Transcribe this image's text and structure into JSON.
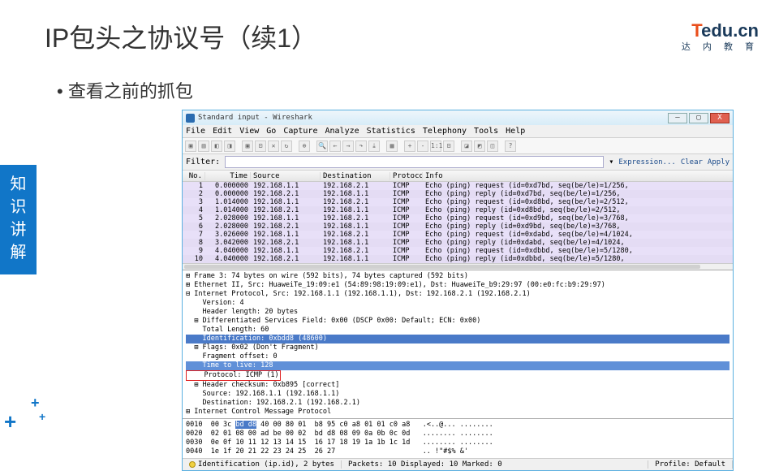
{
  "slide": {
    "title": "IP包头之协议号（续1）",
    "bullet": "• 查看之前的抓包",
    "sidebar": "知\n识\n讲\n解"
  },
  "logo": {
    "t": "T",
    "edu": "edu.cn",
    "sub": "达 内 教 育"
  },
  "window": {
    "title": "Standard input - Wireshark",
    "min": "–",
    "max": "▢",
    "close": "X"
  },
  "menu": [
    "File",
    "Edit",
    "View",
    "Go",
    "Capture",
    "Analyze",
    "Statistics",
    "Telephony",
    "Tools",
    "Help"
  ],
  "filter": {
    "label": "Filter:",
    "placeholder": "",
    "expr": "Expression...",
    "clear": "Clear",
    "apply": "Apply"
  },
  "cols": {
    "no": "No.",
    "time": "Time",
    "src": "Source",
    "dst": "Destination",
    "proto": "Protocol",
    "info": "Info"
  },
  "packets": [
    {
      "no": "1",
      "time": "0.000000",
      "src": "192.168.1.1",
      "dst": "192.168.2.1",
      "proto": "ICMP",
      "info": "Echo (ping) request  (id=0xd7bd, seq(be/le)=1/256,"
    },
    {
      "no": "2",
      "time": "0.000000",
      "src": "192.168.2.1",
      "dst": "192.168.1.1",
      "proto": "ICMP",
      "info": "Echo (ping) reply    (id=0xd7bd, seq(be/le)=1/256,"
    },
    {
      "no": "3",
      "time": "1.014000",
      "src": "192.168.1.1",
      "dst": "192.168.2.1",
      "proto": "ICMP",
      "info": "Echo (ping) request  (id=0xd8bd, seq(be/le)=2/512,"
    },
    {
      "no": "4",
      "time": "1.014000",
      "src": "192.168.2.1",
      "dst": "192.168.1.1",
      "proto": "ICMP",
      "info": "Echo (ping) reply    (id=0xd8bd, seq(be/le)=2/512,"
    },
    {
      "no": "5",
      "time": "2.028000",
      "src": "192.168.1.1",
      "dst": "192.168.2.1",
      "proto": "ICMP",
      "info": "Echo (ping) request  (id=0xd9bd, seq(be/le)=3/768,"
    },
    {
      "no": "6",
      "time": "2.028000",
      "src": "192.168.2.1",
      "dst": "192.168.1.1",
      "proto": "ICMP",
      "info": "Echo (ping) reply    (id=0xd9bd, seq(be/le)=3/768,"
    },
    {
      "no": "7",
      "time": "3.026000",
      "src": "192.168.1.1",
      "dst": "192.168.2.1",
      "proto": "ICMP",
      "info": "Echo (ping) request  (id=0xdabd, seq(be/le)=4/1024,"
    },
    {
      "no": "8",
      "time": "3.042000",
      "src": "192.168.2.1",
      "dst": "192.168.1.1",
      "proto": "ICMP",
      "info": "Echo (ping) reply    (id=0xdabd, seq(be/le)=4/1024,"
    },
    {
      "no": "9",
      "time": "4.040000",
      "src": "192.168.1.1",
      "dst": "192.168.2.1",
      "proto": "ICMP",
      "info": "Echo (ping) request  (id=0xdbbd, seq(be/le)=5/1280,"
    },
    {
      "no": "10",
      "time": "4.040000",
      "src": "192.168.2.1",
      "dst": "192.168.1.1",
      "proto": "ICMP",
      "info": "Echo (ping) reply    (id=0xdbbd, seq(be/le)=5/1280,"
    }
  ],
  "detail": {
    "l0": "⊞ Frame 3: 74 bytes on wire (592 bits), 74 bytes captured (592 bits)",
    "l1": "⊞ Ethernet II, Src: HuaweiTe_19:09:e1 (54:89:98:19:09:e1), Dst: HuaweiTe_b9:29:97 (00:e0:fc:b9:29:97)",
    "l2": "⊟ Internet Protocol, Src: 192.168.1.1 (192.168.1.1), Dst: 192.168.2.1 (192.168.2.1)",
    "l3": "    Version: 4",
    "l4": "    Header length: 20 bytes",
    "l5": "  ⊞ Differentiated Services Field: 0x00 (DSCP 0x00: Default; ECN: 0x00)",
    "l6": "    Total Length: 60",
    "l7": "    Identification: 0xbdd8 (48600)",
    "l8": "  ⊞ Flags: 0x02 (Don't Fragment)",
    "l9": "    Fragment offset: 0",
    "l10": "    Time to live: 128",
    "l11": "    Protocol: ICMP (1)",
    "l12": "  ⊞ Header checksum: 0xb895 [correct]",
    "l13": "    Source: 192.168.1.1 (192.168.1.1)",
    "l14": "    Destination: 192.168.2.1 (192.168.2.1)",
    "l15": "⊞ Internet Control Message Protocol"
  },
  "hex": {
    "r0a": "0010  00 3c ",
    "r0sel": "bd d8",
    "r0b": " 40 00 80 01  b8 95 c0 a8 01 01 c0 a8   .<..@... ........",
    "r1": "0020  02 01 08 00 ad be 00 02  bd d8 08 09 0a 0b 0c 0d   ........ ........",
    "r2": "0030  0e 0f 10 11 12 13 14 15  16 17 18 19 1a 1b 1c 1d   ........ ........",
    "r3": "0040  1e 1f 20 21 22 23 24 25  26 27                     .. !\"#$% &'"
  },
  "status": {
    "s1": "Identification (ip.id), 2 bytes",
    "s2": "Packets: 10 Displayed: 10 Marked: 0",
    "s3": "Profile: Default"
  }
}
